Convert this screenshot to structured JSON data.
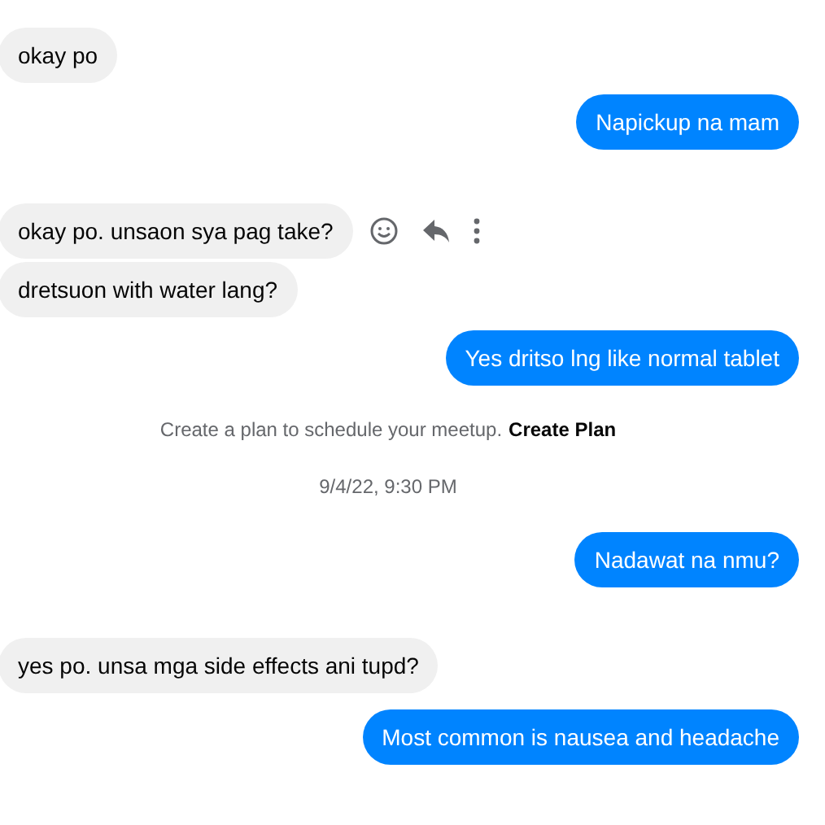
{
  "messages": [
    {
      "kind": "incoming",
      "text": "okay po",
      "actions_visible": false
    },
    {
      "kind": "outgoing",
      "text": "Napickup na mam",
      "actions_visible": false
    },
    {
      "kind": "incoming",
      "text": "okay po. unsaon sya pag take?",
      "actions_visible": true
    },
    {
      "kind": "incoming",
      "text": "dretsuon with water lang?",
      "actions_visible": false
    },
    {
      "kind": "outgoing",
      "text": "Yes dritso lng like normal tablet",
      "actions_visible": false
    },
    {
      "kind": "notice",
      "text": "Create a plan to schedule your meetup.",
      "link": "Create Plan"
    },
    {
      "kind": "timestamp",
      "text": "9/4/22, 9:30 PM"
    },
    {
      "kind": "outgoing",
      "text": "Nadawat na nmu?",
      "actions_visible": false
    },
    {
      "kind": "incoming",
      "text": "yes po. unsa mga side effects ani tupd?",
      "actions_visible": false
    },
    {
      "kind": "outgoing",
      "text": "Most common is nausea and headache",
      "actions_visible": false
    }
  ]
}
